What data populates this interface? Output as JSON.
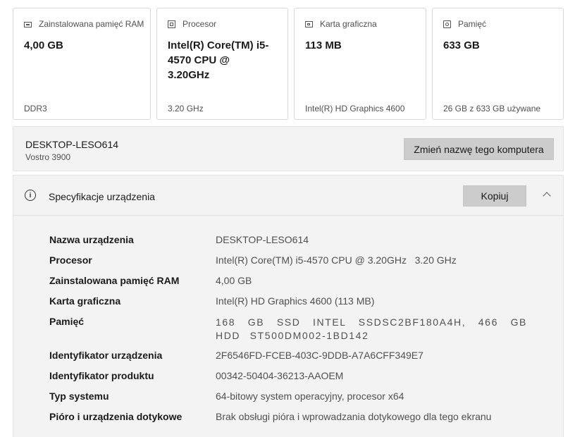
{
  "cards": [
    {
      "label": "Zainstalowana pamięć RAM",
      "value": "4,00 GB",
      "sub": "DDR3",
      "icon": "ram-icon"
    },
    {
      "label": "Procesor",
      "value": "Intel(R) Core(TM) i5-4570 CPU @ 3.20GHz",
      "sub": "3.20 GHz",
      "icon": "cpu-icon"
    },
    {
      "label": "Karta graficzna",
      "value": "113 MB",
      "sub": "Intel(R) HD Graphics 4600",
      "icon": "gpu-icon"
    },
    {
      "label": "Pamięć",
      "value": "633 GB",
      "sub": "26 GB z 633 GB używane",
      "icon": "storage-icon"
    }
  ],
  "device": {
    "name": "DESKTOP-LESO614",
    "model": "Vostro 3900",
    "rename_label": "Zmień nazwę tego komputera"
  },
  "spec": {
    "title": "Specyfikacje urządzenia",
    "info_glyph": "i",
    "copy_label": "Kopiuj",
    "rows": [
      {
        "label": "Nazwa urządzenia",
        "value": "DESKTOP-LESO614"
      },
      {
        "label": "Procesor",
        "value": "Intel(R) Core(TM) i5-4570 CPU @ 3.20GHz   3.20 GHz"
      },
      {
        "label": "Zainstalowana pamięć RAM",
        "value": "4,00 GB"
      },
      {
        "label": "Karta graficzna",
        "value": "Intel(R) HD Graphics 4600 (113 MB)"
      },
      {
        "label": "Pamięć",
        "value": "168 GB SSD INTEL SSDSC2BF180A4H, 466 GB HDD ST500DM002-1BD142"
      },
      {
        "label": "Identyfikator urządzenia",
        "value": "2F6546FD-FCEB-403C-9DDB-A7A6CFF349E7"
      },
      {
        "label": "Identyfikator produktu",
        "value": "00342-50404-36213-AAOEM"
      },
      {
        "label": "Typ systemu",
        "value": "64-bitowy system operacyjny, procesor x64"
      },
      {
        "label": "Pióro i urządzenia dotykowe",
        "value": "Brak obsługi pióra i wprowadzania dotykowego dla tego ekranu"
      }
    ]
  }
}
